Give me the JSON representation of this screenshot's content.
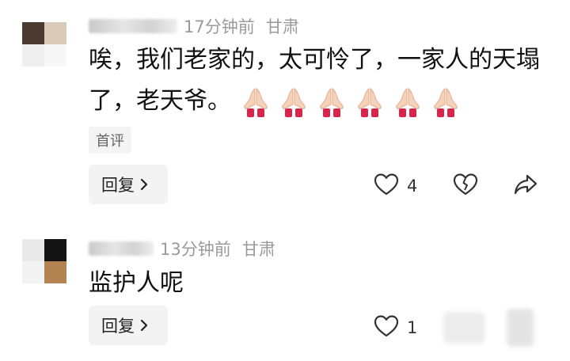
{
  "comments": [
    {
      "time": "17分钟前",
      "location": "甘肃",
      "text": "唉，我们老家的，太可怜了，一家人的天塌了，老天爷。",
      "emoji_count": 6,
      "badge": "首评",
      "reply_label": "回复",
      "like_count": "4",
      "icons": {
        "like": "heart-icon",
        "dislike": "broken-heart-icon",
        "share": "share-icon"
      }
    },
    {
      "time": "13分钟前",
      "location": "甘肃",
      "text": "监护人呢",
      "reply_label": "回复",
      "like_count": "1",
      "icons": {
        "like": "heart-icon"
      }
    }
  ],
  "colors": {
    "meta_text": "#9a9a9a",
    "body_text": "#111111",
    "reply_bg": "#f3f3f3",
    "icon_stroke": "#333333"
  }
}
